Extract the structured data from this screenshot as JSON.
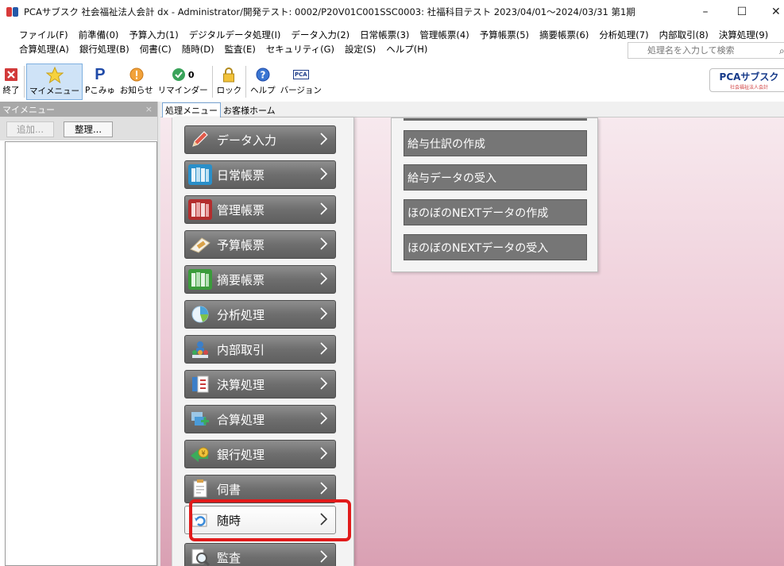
{
  "window": {
    "title": "PCAサブスク 社会福祉法人会計 dx - Administrator/開発テスト: 0002/P20V01C001SSC0003: 社福科目テスト 2023/04/01～2024/03/31 第1期",
    "controls": {
      "minimize": "–",
      "maximize": "☐",
      "close": "✕"
    }
  },
  "menubar": {
    "row1": [
      "ファイル(F)",
      "前準備(0)",
      "予算入力(1)",
      "デジタルデータ処理(I)",
      "データ入力(2)",
      "日常帳票(3)",
      "管理帳票(4)",
      "予算帳票(5)",
      "摘要帳票(6)",
      "分析処理(7)",
      "内部取引(8)",
      "決算処理(9)"
    ],
    "row2": [
      "合算処理(A)",
      "銀行処理(B)",
      "伺書(C)",
      "随時(D)",
      "監査(E)",
      "セキュリティ(G)",
      "設定(S)",
      "ヘルプ(H)"
    ],
    "search_placeholder": "処理名を入力して検索"
  },
  "toolbar": {
    "items": [
      {
        "label": "終了",
        "icon": "exit-icon"
      },
      {
        "label": "マイメニュー",
        "icon": "star-icon"
      },
      {
        "label": "Pこみゅ",
        "icon": "p-community-icon"
      },
      {
        "label": "お知らせ",
        "icon": "notice-icon"
      },
      {
        "label": "リマインダー",
        "icon": "reminder-icon",
        "badge": "0"
      },
      {
        "label": "ロック",
        "icon": "lock-icon"
      },
      {
        "label": "ヘルプ",
        "icon": "help-icon"
      },
      {
        "label": "バージョン",
        "icon": "version-icon",
        "icon_text": "PCA"
      }
    ],
    "brand": {
      "name": "PCAサブスク",
      "sub": "社会福祉法人会計"
    }
  },
  "left_panel": {
    "title": "マイメニュー",
    "close": "×",
    "add_button": "追加...",
    "organize_button": "整理..."
  },
  "tabs": [
    "処理メニュー",
    "お客様ホーム"
  ],
  "main_menu": {
    "items": [
      {
        "label": "データ入力",
        "icon": "pencil-icon",
        "color": "#cc3b3b"
      },
      {
        "label": "日常帳票",
        "icon": "books-icon",
        "color": "#2a8fc9"
      },
      {
        "label": "管理帳票",
        "icon": "books-red-icon",
        "color": "#b32d2d"
      },
      {
        "label": "予算帳票",
        "icon": "calculator-icon",
        "color": "#d9a24a"
      },
      {
        "label": "摘要帳票",
        "icon": "books-green-icon",
        "color": "#3b9b3b"
      },
      {
        "label": "分析処理",
        "icon": "pie-chart-icon",
        "color": "#4aa3d9"
      },
      {
        "label": "内部取引",
        "icon": "people-icon",
        "color": "#3b7fc9"
      },
      {
        "label": "決算処理",
        "icon": "document-icon",
        "color": "#c93b3b"
      },
      {
        "label": "合算処理",
        "icon": "merge-icon",
        "color": "#4a9bd9"
      },
      {
        "label": "銀行処理",
        "icon": "bank-icon",
        "color": "#3bab5b"
      },
      {
        "label": "伺書",
        "icon": "memo-icon",
        "color": "#d9a24a"
      },
      {
        "label": "随時",
        "icon": "refresh-icon",
        "color": "#3b8bd9"
      },
      {
        "label": "監査",
        "icon": "magnifier-icon",
        "color": "#6f6f6f"
      }
    ],
    "selected": "随時"
  },
  "submenu": {
    "items": [
      "給与仕訳の作成",
      "給与データの受入",
      "ほのぼのNEXTデータの作成",
      "ほのぼのNEXTデータの受入"
    ]
  }
}
